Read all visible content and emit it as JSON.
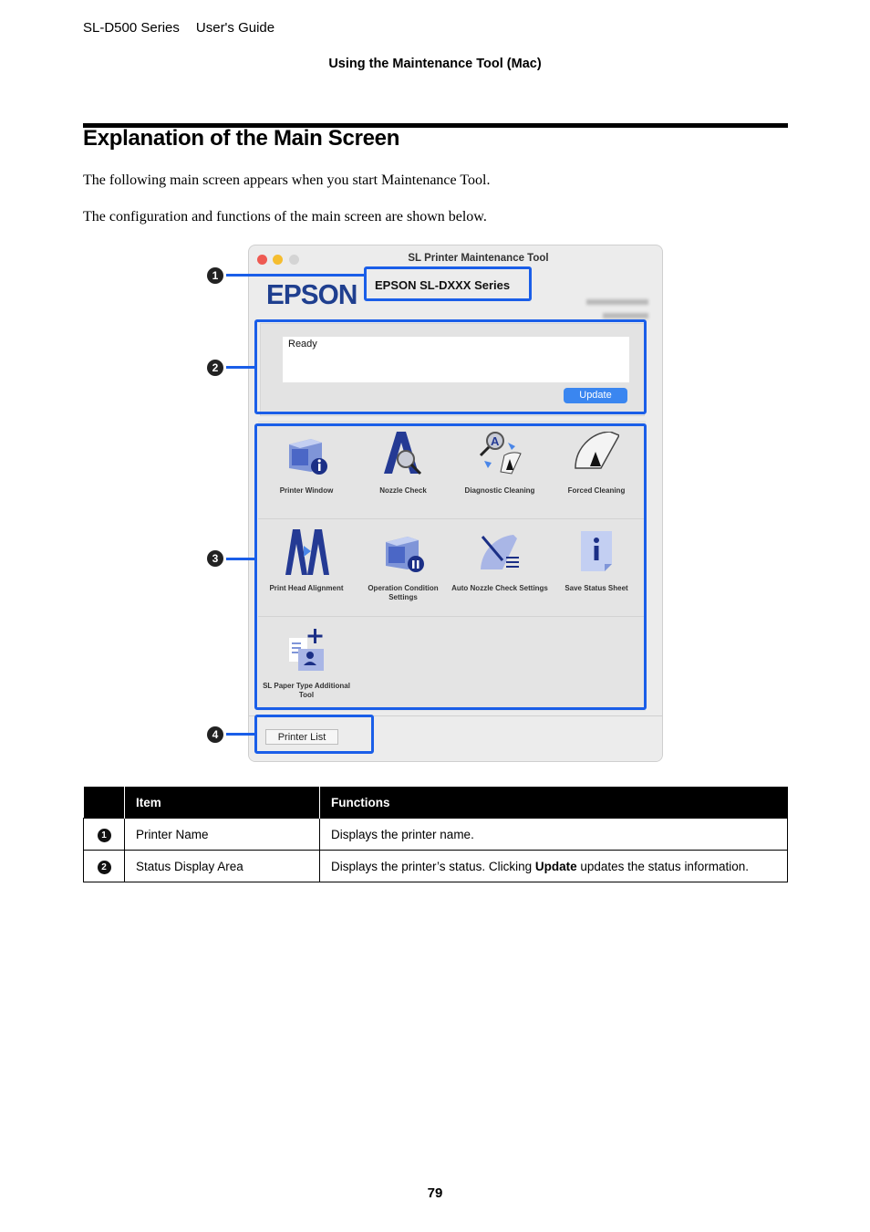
{
  "header": {
    "product": "SL-D500 Series",
    "guide": "User's Guide",
    "section": "Using the Maintenance Tool (Mac)"
  },
  "title": "Explanation of the Main Screen",
  "paragraphs": [
    "The following main screen appears when you start Maintenance Tool.",
    "The configuration and functions of the main screen are shown below."
  ],
  "window": {
    "title": "SL Printer Maintenance Tool",
    "brand": "EPSON",
    "printer_name": "EPSON SL-DXXX Series",
    "status_text": "Ready",
    "update_label": "Update",
    "tools": [
      {
        "label": "Printer Window",
        "icon": "printer-info-icon"
      },
      {
        "label": "Nozzle Check",
        "icon": "nozzle-check-icon"
      },
      {
        "label": "Diagnostic Cleaning",
        "icon": "diagnostic-cleaning-icon"
      },
      {
        "label": "Forced Cleaning",
        "icon": "forced-cleaning-icon"
      },
      {
        "label": "Print Head Alignment",
        "icon": "head-alignment-icon"
      },
      {
        "label": "Operation Condition Settings",
        "icon": "operation-settings-icon"
      },
      {
        "label": "Auto Nozzle Check Settings",
        "icon": "auto-nozzle-icon"
      },
      {
        "label": "Save Status Sheet",
        "icon": "status-sheet-icon"
      },
      {
        "label": "SL Paper Type Additional Tool",
        "icon": "paper-type-add-icon"
      }
    ],
    "printer_list_label": "Printer List"
  },
  "callouts": [
    "1",
    "2",
    "3",
    "4"
  ],
  "table": {
    "headers": [
      "",
      "Item",
      "Functions"
    ],
    "rows": [
      {
        "num": "1",
        "item": "Printer Name",
        "function": "Displays the printer name."
      },
      {
        "num": "2",
        "item": "Status Display Area",
        "function_pre": "Displays the printer’s status. Clicking ",
        "function_bold": "Update",
        "function_post": " updates the status information."
      }
    ]
  },
  "page_number": "79",
  "colors": {
    "highlight": "#1a5ee8",
    "brand": "#1f3f8f",
    "update_button": "#3a86f0"
  }
}
